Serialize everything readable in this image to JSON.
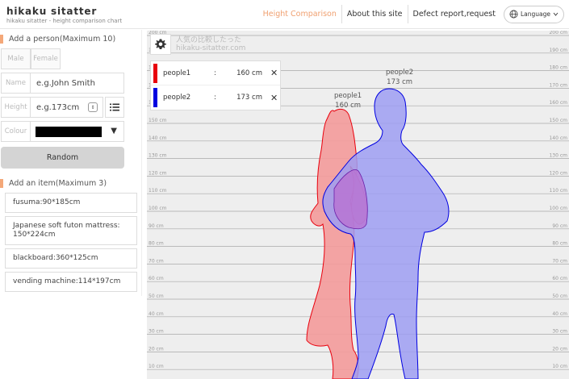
{
  "app": {
    "title": "hikaku sitatter",
    "subtitle": "hikaku sitatter - height comparison chart"
  },
  "nav": {
    "height_comparison": "Height Comparison",
    "about": "About this site",
    "defect": "Defect report,request",
    "language": "Language"
  },
  "add_person": {
    "title": "Add a person(Maximum 10)",
    "male": "Male",
    "female": "Female",
    "name_label": "Name",
    "name_placeholder": "e.g.John Smith",
    "height_label": "Height",
    "height_placeholder": "e.g.173cm",
    "colour_label": "Colour",
    "colour_value": "#000000",
    "random_label": "Random"
  },
  "add_item": {
    "title": "Add an item(Maximum 3)",
    "items": [
      "fusuma:90*185cm",
      "Japanese soft futon mattress: 150*224cm",
      "blackboard:360*125cm",
      "vending machine:114*197cm"
    ]
  },
  "chart": {
    "watermark_line1": "人気の比較したった",
    "watermark_line2": "hikaku-sitatter.com",
    "unit": "cm",
    "people": [
      {
        "name": "people1",
        "height": 160,
        "color": "#e8000d",
        "fill": "#f39a9a"
      },
      {
        "name": "people2",
        "height": 173,
        "color": "#0000e0",
        "fill": "#9d9df2"
      }
    ],
    "legend_people1_name": "people1",
    "legend_people1_height": "160 cm",
    "legend_people2_name": "people2",
    "legend_people2_height": "173 cm",
    "label_people1_line1": "people1",
    "label_people1_line2": "160 cm",
    "label_people2_line1": "people2",
    "label_people2_line2": "173 cm",
    "ticks": [
      200,
      190,
      180,
      170,
      160,
      150,
      140,
      130,
      120,
      110,
      100,
      90,
      80,
      70,
      60,
      50,
      40,
      30,
      20,
      10
    ]
  }
}
